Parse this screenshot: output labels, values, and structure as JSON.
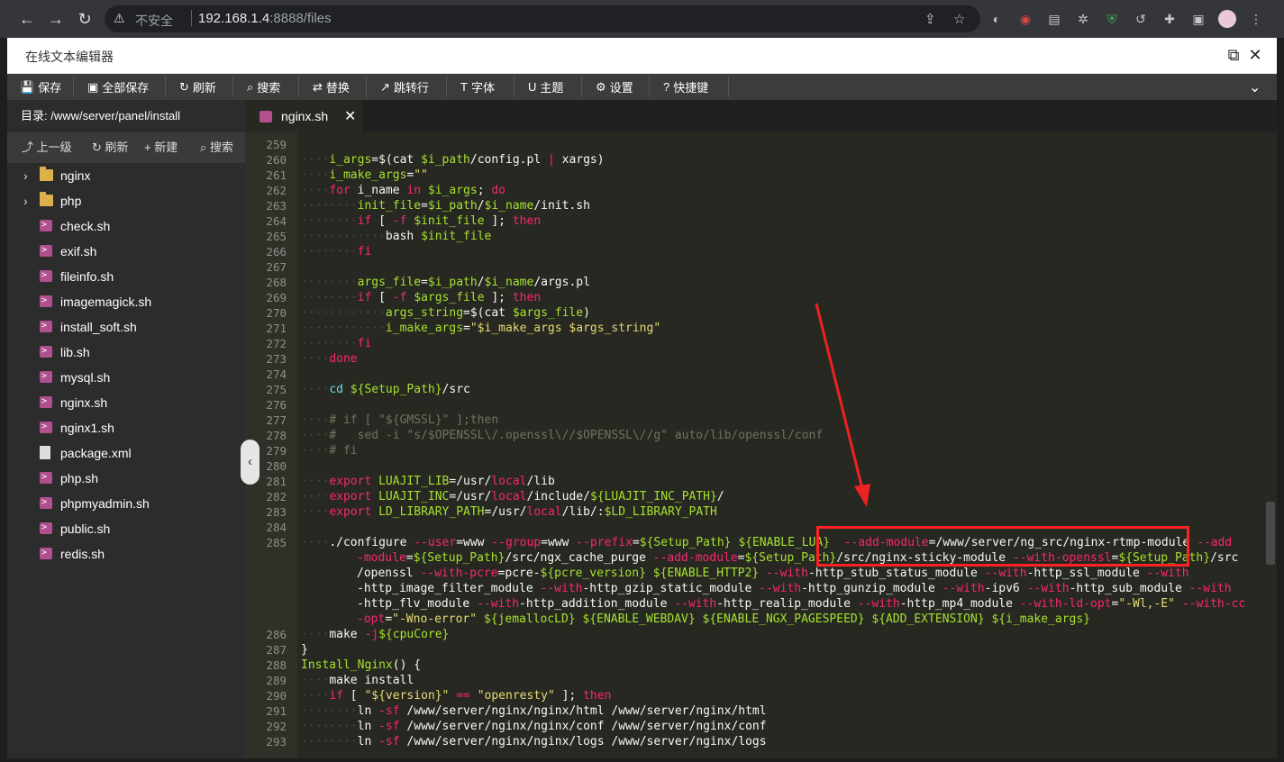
{
  "browser": {
    "insecure_label": "不安全",
    "url_host": "192.168.1.4",
    "url_path": ":8888/files"
  },
  "window": {
    "title": "在线文本编辑器"
  },
  "toolbar": {
    "items": [
      {
        "label": "保存",
        "icon": "💾"
      },
      {
        "label": "全部保存",
        "icon": "▣"
      },
      {
        "label": "刷新",
        "icon": "↻"
      },
      {
        "label": "搜索",
        "icon": "⌕"
      },
      {
        "label": "替换",
        "icon": "⇄"
      },
      {
        "label": "跳转行",
        "icon": "↗"
      },
      {
        "label": "字体",
        "icon": "T"
      },
      {
        "label": "主题",
        "icon": "U"
      },
      {
        "label": "设置",
        "icon": "⚙"
      },
      {
        "label": "快捷键",
        "icon": "?"
      }
    ]
  },
  "sidebar": {
    "dir_label": "目录: /www/server/panel/install",
    "actions": [
      {
        "label": "上一级",
        "icon": "⤴"
      },
      {
        "label": "刷新",
        "icon": "↻"
      },
      {
        "label": "新建",
        "icon": "+"
      },
      {
        "label": "搜索",
        "icon": "⌕"
      }
    ],
    "files": [
      {
        "name": "nginx",
        "type": "folder"
      },
      {
        "name": "php",
        "type": "folder"
      },
      {
        "name": "check.sh",
        "type": "sh"
      },
      {
        "name": "exif.sh",
        "type": "sh"
      },
      {
        "name": "fileinfo.sh",
        "type": "sh"
      },
      {
        "name": "imagemagick.sh",
        "type": "sh"
      },
      {
        "name": "install_soft.sh",
        "type": "sh"
      },
      {
        "name": "lib.sh",
        "type": "sh"
      },
      {
        "name": "mysql.sh",
        "type": "sh"
      },
      {
        "name": "nginx.sh",
        "type": "sh"
      },
      {
        "name": "nginx1.sh",
        "type": "sh"
      },
      {
        "name": "package.xml",
        "type": "doc"
      },
      {
        "name": "php.sh",
        "type": "sh"
      },
      {
        "name": "phpmyadmin.sh",
        "type": "sh"
      },
      {
        "name": "public.sh",
        "type": "sh"
      },
      {
        "name": "redis.sh",
        "type": "sh"
      }
    ]
  },
  "tab": {
    "name": "nginx.sh"
  },
  "editor": {
    "lines": [
      {
        "n": "259",
        "wrap": 0,
        "segs": []
      },
      {
        "n": "260",
        "wrap": 0,
        "segs": [
          [
            "i",
            "····"
          ],
          [
            "v",
            "i_args"
          ],
          [
            "w",
            "=$(cat "
          ],
          [
            "v",
            "$i_path"
          ],
          [
            "w",
            "/config.pl "
          ],
          [
            "k",
            "|"
          ],
          [
            "w",
            " xargs)"
          ]
        ]
      },
      {
        "n": "261",
        "wrap": 0,
        "segs": [
          [
            "i",
            "····"
          ],
          [
            "v",
            "i_make_args"
          ],
          [
            "w",
            "="
          ],
          [
            "s",
            "\"\""
          ]
        ]
      },
      {
        "n": "262",
        "wrap": 0,
        "segs": [
          [
            "i",
            "····"
          ],
          [
            "k",
            "for"
          ],
          [
            "w",
            " i_name "
          ],
          [
            "k",
            "in"
          ],
          [
            "w",
            " "
          ],
          [
            "v",
            "$i_args"
          ],
          [
            "w",
            "; "
          ],
          [
            "k",
            "do"
          ]
        ]
      },
      {
        "n": "263",
        "wrap": 0,
        "segs": [
          [
            "i",
            "········"
          ],
          [
            "v",
            "init_file"
          ],
          [
            "w",
            "="
          ],
          [
            "v",
            "$i_path"
          ],
          [
            "w",
            "/"
          ],
          [
            "v",
            "$i_name"
          ],
          [
            "w",
            "/init.sh"
          ]
        ]
      },
      {
        "n": "264",
        "wrap": 0,
        "segs": [
          [
            "i",
            "········"
          ],
          [
            "k",
            "if"
          ],
          [
            "w",
            " [ "
          ],
          [
            "k",
            "-f"
          ],
          [
            "w",
            " "
          ],
          [
            "v",
            "$init_file"
          ],
          [
            "w",
            " ]; "
          ],
          [
            "k",
            "then"
          ]
        ]
      },
      {
        "n": "265",
        "wrap": 0,
        "segs": [
          [
            "i",
            "············"
          ],
          [
            "w",
            "bash "
          ],
          [
            "v",
            "$init_file"
          ]
        ]
      },
      {
        "n": "266",
        "wrap": 0,
        "segs": [
          [
            "i",
            "········"
          ],
          [
            "k",
            "fi"
          ]
        ]
      },
      {
        "n": "267",
        "wrap": 0,
        "segs": []
      },
      {
        "n": "268",
        "wrap": 0,
        "segs": [
          [
            "i",
            "········"
          ],
          [
            "v",
            "args_file"
          ],
          [
            "w",
            "="
          ],
          [
            "v",
            "$i_path"
          ],
          [
            "w",
            "/"
          ],
          [
            "v",
            "$i_name"
          ],
          [
            "w",
            "/args.pl"
          ]
        ]
      },
      {
        "n": "269",
        "wrap": 0,
        "segs": [
          [
            "i",
            "········"
          ],
          [
            "k",
            "if"
          ],
          [
            "w",
            " [ "
          ],
          [
            "k",
            "-f"
          ],
          [
            "w",
            " "
          ],
          [
            "v",
            "$args_file"
          ],
          [
            "w",
            " ]; "
          ],
          [
            "k",
            "then"
          ]
        ]
      },
      {
        "n": "270",
        "wrap": 0,
        "segs": [
          [
            "i",
            "············"
          ],
          [
            "v",
            "args_string"
          ],
          [
            "w",
            "=$(cat "
          ],
          [
            "v",
            "$args_file"
          ],
          [
            "w",
            ")"
          ]
        ]
      },
      {
        "n": "271",
        "wrap": 0,
        "segs": [
          [
            "i",
            "············"
          ],
          [
            "v",
            "i_make_args"
          ],
          [
            "w",
            "="
          ],
          [
            "s",
            "\"$i_make_args $args_string\""
          ]
        ]
      },
      {
        "n": "272",
        "wrap": 0,
        "segs": [
          [
            "i",
            "········"
          ],
          [
            "k",
            "fi"
          ]
        ]
      },
      {
        "n": "273",
        "wrap": 0,
        "segs": [
          [
            "i",
            "····"
          ],
          [
            "k",
            "done"
          ]
        ]
      },
      {
        "n": "274",
        "wrap": 0,
        "segs": []
      },
      {
        "n": "275",
        "wrap": 0,
        "segs": [
          [
            "i",
            "····"
          ],
          [
            "f",
            "cd"
          ],
          [
            "w",
            " "
          ],
          [
            "v",
            "${Setup_Path}"
          ],
          [
            "w",
            "/src"
          ]
        ]
      },
      {
        "n": "276",
        "wrap": 0,
        "segs": []
      },
      {
        "n": "277",
        "wrap": 0,
        "segs": [
          [
            "i",
            "····"
          ],
          [
            "c",
            "# if [ \"${GMSSL}\" ];then"
          ]
        ]
      },
      {
        "n": "278",
        "wrap": 0,
        "segs": [
          [
            "i",
            "····"
          ],
          [
            "c",
            "#   sed -i \"s/$OPENSSL\\/.openssl\\//$OPENSSL\\//g\" auto/lib/openssl/conf"
          ]
        ]
      },
      {
        "n": "279",
        "wrap": 0,
        "segs": [
          [
            "i",
            "····"
          ],
          [
            "c",
            "# fi"
          ]
        ]
      },
      {
        "n": "280",
        "wrap": 0,
        "segs": []
      },
      {
        "n": "281",
        "wrap": 0,
        "segs": [
          [
            "i",
            "····"
          ],
          [
            "k",
            "export"
          ],
          [
            "w",
            " "
          ],
          [
            "v",
            "LUAJIT_LIB"
          ],
          [
            "w",
            "=/usr/"
          ],
          [
            "k",
            "local"
          ],
          [
            "w",
            "/lib"
          ]
        ]
      },
      {
        "n": "282",
        "wrap": 0,
        "segs": [
          [
            "i",
            "····"
          ],
          [
            "k",
            "export"
          ],
          [
            "w",
            " "
          ],
          [
            "v",
            "LUAJIT_INC"
          ],
          [
            "w",
            "=/usr/"
          ],
          [
            "k",
            "local"
          ],
          [
            "w",
            "/include/"
          ],
          [
            "v",
            "${LUAJIT_INC_PATH}"
          ],
          [
            "w",
            "/"
          ]
        ]
      },
      {
        "n": "283",
        "wrap": 0,
        "segs": [
          [
            "i",
            "····"
          ],
          [
            "k",
            "export"
          ],
          [
            "w",
            " "
          ],
          [
            "v",
            "LD_LIBRARY_PATH"
          ],
          [
            "w",
            "=/usr/"
          ],
          [
            "k",
            "local"
          ],
          [
            "w",
            "/lib/:"
          ],
          [
            "v",
            "$LD_LIBRARY_PATH"
          ]
        ]
      },
      {
        "n": "284",
        "wrap": 0,
        "segs": []
      },
      {
        "n": "285",
        "wrap": 0,
        "segs": [
          [
            "i",
            "····"
          ],
          [
            "w",
            "./configure "
          ],
          [
            "k",
            "--user"
          ],
          [
            "w",
            "=www "
          ],
          [
            "k",
            "--group"
          ],
          [
            "w",
            "=www "
          ],
          [
            "k",
            "--prefix"
          ],
          [
            "w",
            "="
          ],
          [
            "v",
            "${Setup_Path}"
          ],
          [
            "w",
            " "
          ],
          [
            "v",
            "${ENABLE_LUA}"
          ],
          [
            "w",
            "  "
          ],
          [
            "k",
            "--add-module"
          ],
          [
            "w",
            "=/www/server/ng_src/nginx-rtmp-module "
          ],
          [
            "k",
            "--add"
          ]
        ]
      },
      {
        "n": "",
        "wrap": 1,
        "segs": [
          [
            "k",
            "-module"
          ],
          [
            "w",
            "="
          ],
          [
            "v",
            "${Setup_Path}"
          ],
          [
            "w",
            "/src/ngx_cache_purge "
          ],
          [
            "k",
            "--add-module"
          ],
          [
            "w",
            "="
          ],
          [
            "v",
            "${Setup_Path}"
          ],
          [
            "w",
            "/src/nginx-sticky-module "
          ],
          [
            "k",
            "--with-openssl"
          ],
          [
            "w",
            "="
          ],
          [
            "v",
            "${Setup_Path}"
          ],
          [
            "w",
            "/src"
          ]
        ]
      },
      {
        "n": "",
        "wrap": 1,
        "segs": [
          [
            "w",
            "/openssl "
          ],
          [
            "k",
            "--with-pcre"
          ],
          [
            "w",
            "=pcre-"
          ],
          [
            "v",
            "${pcre_version}"
          ],
          [
            "w",
            " "
          ],
          [
            "v",
            "${ENABLE_HTTP2}"
          ],
          [
            "w",
            " "
          ],
          [
            "k",
            "--with"
          ],
          [
            "w",
            "-http_stub_status_module "
          ],
          [
            "k",
            "--with"
          ],
          [
            "w",
            "-http_ssl_module "
          ],
          [
            "k",
            "--with"
          ]
        ]
      },
      {
        "n": "",
        "wrap": 1,
        "segs": [
          [
            "w",
            "-http_image_filter_module "
          ],
          [
            "k",
            "--with"
          ],
          [
            "w",
            "-http_gzip_static_module "
          ],
          [
            "k",
            "--with"
          ],
          [
            "w",
            "-http_gunzip_module "
          ],
          [
            "k",
            "--with"
          ],
          [
            "w",
            "-ipv6 "
          ],
          [
            "k",
            "--with"
          ],
          [
            "w",
            "-http_sub_module "
          ],
          [
            "k",
            "--with"
          ]
        ]
      },
      {
        "n": "",
        "wrap": 1,
        "segs": [
          [
            "w",
            "-http_flv_module "
          ],
          [
            "k",
            "--with"
          ],
          [
            "w",
            "-http_addition_module "
          ],
          [
            "k",
            "--with"
          ],
          [
            "w",
            "-http_realip_module "
          ],
          [
            "k",
            "--with"
          ],
          [
            "w",
            "-http_mp4_module "
          ],
          [
            "k",
            "--with-ld-opt"
          ],
          [
            "w",
            "="
          ],
          [
            "s",
            "\"-Wl,-E\""
          ],
          [
            "w",
            " "
          ],
          [
            "k",
            "--with-cc"
          ]
        ]
      },
      {
        "n": "",
        "wrap": 1,
        "segs": [
          [
            "k",
            "-opt"
          ],
          [
            "w",
            "="
          ],
          [
            "s",
            "\"-Wno-error\""
          ],
          [
            "w",
            " "
          ],
          [
            "v",
            "${jemallocLD}"
          ],
          [
            "w",
            " "
          ],
          [
            "v",
            "${ENABLE_WEBDAV}"
          ],
          [
            "w",
            " "
          ],
          [
            "v",
            "${ENABLE_NGX_PAGESPEED}"
          ],
          [
            "w",
            " "
          ],
          [
            "v",
            "${ADD_EXTENSION}"
          ],
          [
            "w",
            " "
          ],
          [
            "v",
            "${i_make_args}"
          ]
        ]
      },
      {
        "n": "286",
        "wrap": 0,
        "segs": [
          [
            "i",
            "····"
          ],
          [
            "w",
            "make "
          ],
          [
            "k",
            "-j"
          ],
          [
            "v",
            "${cpuCore}"
          ]
        ]
      },
      {
        "n": "287",
        "wrap": 0,
        "segs": [
          [
            "w",
            "}"
          ]
        ]
      },
      {
        "n": "288",
        "wrap": 0,
        "segs": [
          [
            "v",
            "Install_Nginx"
          ],
          [
            "w",
            "() {"
          ]
        ]
      },
      {
        "n": "289",
        "wrap": 0,
        "segs": [
          [
            "i",
            "····"
          ],
          [
            "w",
            "make install"
          ]
        ]
      },
      {
        "n": "290",
        "wrap": 0,
        "segs": [
          [
            "i",
            "····"
          ],
          [
            "k",
            "if"
          ],
          [
            "w",
            " [ "
          ],
          [
            "s",
            "\"${version}\""
          ],
          [
            "w",
            " "
          ],
          [
            "k",
            "=="
          ],
          [
            "w",
            " "
          ],
          [
            "s",
            "\"openresty\""
          ],
          [
            "w",
            " ]; "
          ],
          [
            "k",
            "then"
          ]
        ]
      },
      {
        "n": "291",
        "wrap": 0,
        "segs": [
          [
            "i",
            "········"
          ],
          [
            "w",
            "ln "
          ],
          [
            "k",
            "-sf"
          ],
          [
            "w",
            " /www/server/nginx/nginx/html /www/server/nginx/html"
          ]
        ]
      },
      {
        "n": "292",
        "wrap": 0,
        "segs": [
          [
            "i",
            "········"
          ],
          [
            "w",
            "ln "
          ],
          [
            "k",
            "-sf"
          ],
          [
            "w",
            " /www/server/nginx/nginx/conf /www/server/nginx/conf"
          ]
        ]
      },
      {
        "n": "293",
        "wrap": 0,
        "segs": [
          [
            "i",
            "········"
          ],
          [
            "w",
            "ln "
          ],
          [
            "k",
            "-sf"
          ],
          [
            "w",
            " /www/server/nginx/nginx/logs /www/server/nginx/logs"
          ]
        ]
      }
    ]
  }
}
